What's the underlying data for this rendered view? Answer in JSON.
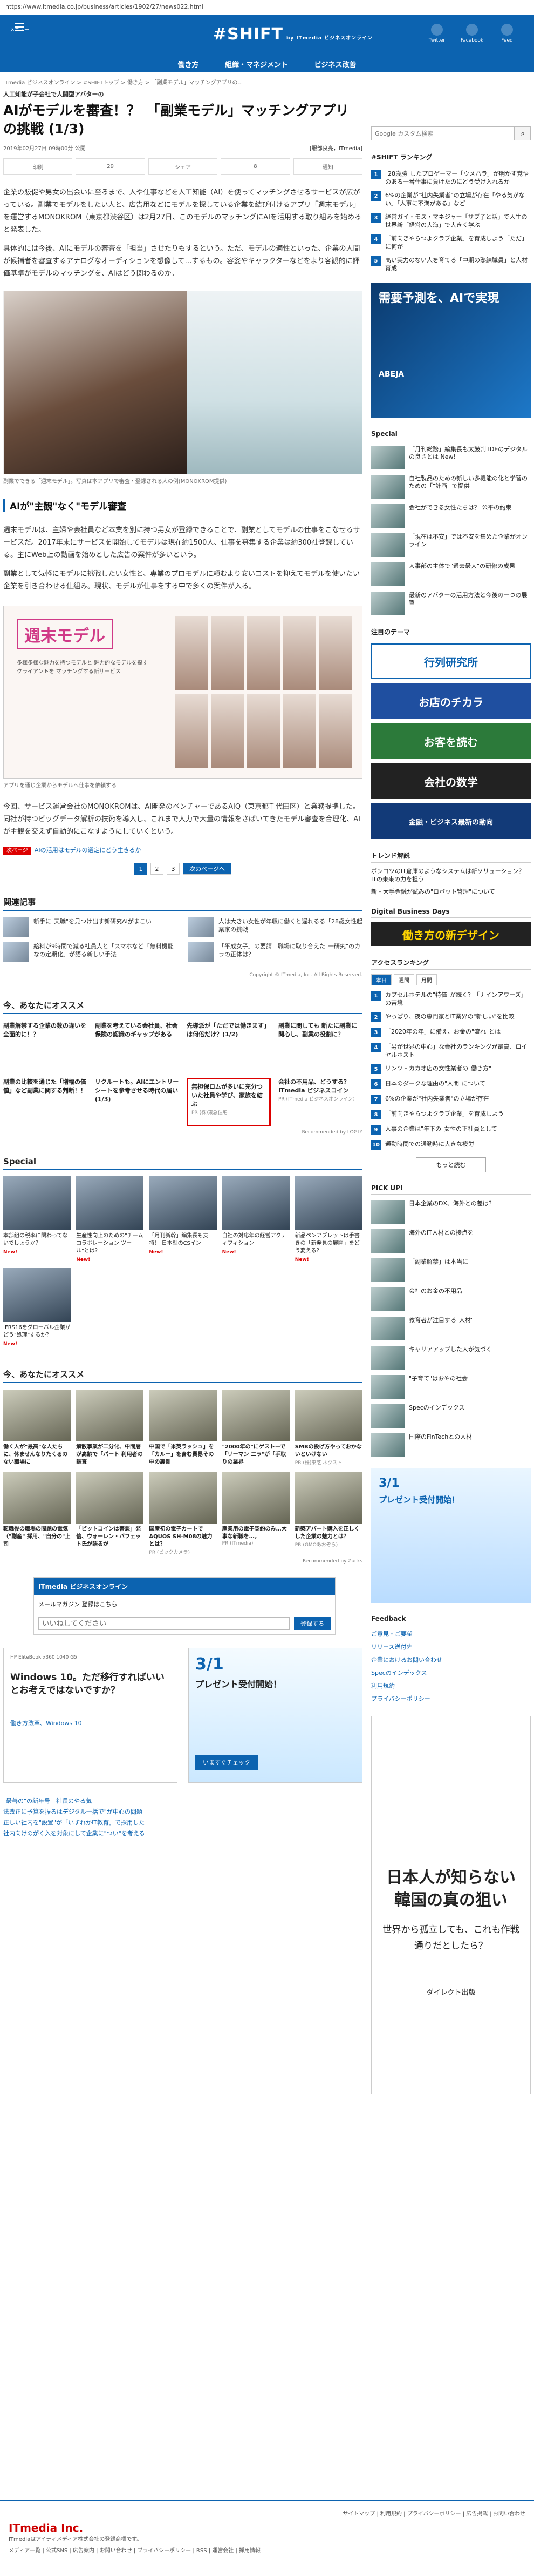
{
  "url": "https://www.itmedia.co.jp/business/articles/1902/27/news022.html",
  "header": {
    "menu_label": "メニュー",
    "logo": "#SHIFT",
    "brand": "by ITmedia ビジネスオンライン",
    "twitter": "Twitter",
    "facebook": "Facebook",
    "feed": "Feed"
  },
  "subnav": [
    "働き方",
    "組織・マネジメント",
    "ビジネス改善"
  ],
  "breadcrumb": "ITmedia ビジネスオンライン > #SHIFTトップ > 働き方 > 「副業モデル」マッチングアプリの...",
  "category": "人工知能が子会社で人間型アバターの",
  "title": "AIがモデルを審査！？　「副業モデル」マッチングアプリの挑戦 (1/3)",
  "meta": {
    "date": "2019年02月27日 09時00分 公開",
    "author": "[服部良亮，ITmedia]"
  },
  "share": [
    "印刷",
    "29",
    "シェア",
    "8",
    "通知"
  ],
  "intro": "企業の販促や男女の出会いに至るまで、人や仕事などを人工知能（AI）を使ってマッチングさせるサービスが広がっている。副業でモデルをしたい人と、広告用などにモデルを探している企業を結び付けるアプリ「週末モデル」を運営するMONOKROM（東京都渋谷区）は2月27日、このモデルのマッチングにAIを活用する取り組みを始めると発表した。",
  "intro2": "具体的には今後、AIにモデルの審査を「担当」させたりもするという。ただ、モデルの適性といった、企業の人間が候補者を審査するアナログなオーディションを想像して…するもの。容姿やキャラクターなどをより客観的に評価基準がモデルのマッチングを、AIはどう関わるのか。",
  "img_caption": "副業でできる「週末モデル」。写真は本アプリで審査・登録される人の例(MONOKROM提供)",
  "section1": "AIが\"主観\"なく\"モデル審査",
  "body1": "週末モデルは、主婦や会社員など本業を別に持つ男女が登録できることで、副業としてモデルの仕事をこなせるサービスだ。2017年末にサービスを開始してモデルは現在約1500人、仕事を募集する企業は約300社登録している。主にWeb上の動画を始めとした広告の案件が多いという。",
  "body2": "副業として気軽にモデルに挑戦したい女性と、専業のプロモデルに頼むより安いコストを抑えてモデルを使いたい企業を引き合わせる仕組み。現状、モデルが仕事をする中で多くの案件が入る。",
  "ad_image": {
    "logo": "週末モデル",
    "sub": "多様多様な魅力を持つモデルと 魅力的なモデルを探すクライアントを マッチングする新サービス",
    "cap": "アプリを通じ企業からモデルへ仕事を依頼する"
  },
  "body3": "今回、サービス運営会社のMONOKROMは、AI開発のベンチャーであるAIQ（東京都千代田区）と業務提携した。同社が持つビッグデータ解析の技術を導入し、これまで人力で大量の情報をさばいてきたモデル審査を合理化、AIが主観を交えず自動的にこなすようにしていくという。",
  "tag": {
    "label": "次ページ",
    "link": "AIの活用はモデルの選定にどう生きるか"
  },
  "pager": {
    "pages": [
      "1",
      "2",
      "3"
    ],
    "next": "次のページへ"
  },
  "related": {
    "heading": "関連記事",
    "items": [
      "新手に\"天職\"を見つけ出す新研究AIがまこい",
      "給料が9時間で減る社員人と「スマホなど「無料機能なの定期化」が語る新しい手法",
      "人は大きい女性が年収に働くと遅れるる「28歳女性起業家の挑戦",
      "「平成女子」の要請　職場に取り合えた\"一研究\"のカラの正体は？"
    ],
    "copyright": "Copyright © ITmedia, Inc. All Rights Reserved."
  },
  "recommend": {
    "heading": "今、あなたにオススメ",
    "items": [
      {
        "t": "副業解禁する企業の数の違いを全面的に！？",
        "s": ""
      },
      {
        "t": "副業を考えている会社員、社会保険の認識のギャップがある",
        "s": ""
      },
      {
        "t": "先導派が「ただでは働きます」は何倍だけ？(1/2)",
        "s": ""
      },
      {
        "t": "副業に関しても 新たに副業に関心し、副業の役割に？",
        "s": ""
      },
      {
        "t": "副業の比較を通じた「増幅の価値」など副業に関する判断！！",
        "s": ""
      },
      {
        "t": "リクルートも。AIにエントリーシートを参考させる時代の届い(1/3)",
        "s": ""
      },
      {
        "t": "無担保ロムが多いに充分ついた社員や学び、家族を結ぶ",
        "s": "PR (株)東急住宅"
      },
      {
        "t": "会社の不用品、どうする？ITmedia ビジネスコイン",
        "s": "PR (ITmedia ビジネスオンライン)"
      }
    ],
    "by": "Recommended by LOGLY"
  },
  "special": {
    "heading": "Special",
    "items": [
      {
        "t": "本部組の税率に関わってないでしょうか？",
        "b": "New!"
      },
      {
        "t": "生産性向上のための\"チーム コラボレーション ツール\"とは？",
        "b": "New!"
      },
      {
        "t": "「月刊新幹」編集長も支持！ 日本型のCSイン",
        "b": "New!"
      },
      {
        "t": "自社の対応年の経営アクティフィション",
        "b": "New!"
      },
      {
        "t": "新品ペンアブレットは手書きの「新発見の展開」をどう変える？",
        "b": "New!"
      },
      {
        "t": "IFRS16をグローバル企業がどう\"処理\"するか？",
        "b": "New!"
      }
    ]
  },
  "recommend2": {
    "heading": "今、あなたにオススメ",
    "items": [
      {
        "t": "働く人が\"最高\"な人たちに、休ませんなりたくるのない職場に",
        "s": ""
      },
      {
        "t": "解散事業が二分化、中間層が高齢で「パート 利用者の調査",
        "s": ""
      },
      {
        "t": "中国で「米英ラッシュ」を「カルー」を含む貿易その中の裏側",
        "s": ""
      },
      {
        "t": "\"2000年の\"にゲストーで「リーマン 二ラ\"が「手取りの業界",
        "s": ""
      },
      {
        "t": "SMBの投げ方やっておかないといけない",
        "s": "PR (株)東芝 ネクスト"
      },
      {
        "t": "転職後の職場の問題の電気（\"副産\" 採用、\"自分の\"上司",
        "s": ""
      },
      {
        "t": "「ビットコインは害悪」発信、ウォーレン・バフェット氏が語るが",
        "s": ""
      },
      {
        "t": "国産初の電子カートでAQUOS SH-M08の魅力とは？",
        "s": "PR (ビックカメラ)"
      },
      {
        "t": "産業用の電子契約のみ…大事な新職を…。",
        "s": "PR (ITmedia)"
      },
      {
        "t": "新築アパート購入を正しくした企業の魅力とは？",
        "s": "PR (GMOあおぞら)"
      }
    ],
    "by": "Recommended by Zucks"
  },
  "newsletter": {
    "title": "ITmedia ビジネスオンライン",
    "sub": "メールマガジン 登録はこちら",
    "placeholder": "いいねしてください",
    "btn": "登録する"
  },
  "ad_pc": {
    "brand": "HP EliteBook x360 1040 G5",
    "h": "Windows 10。ただ移行すればいいとお考えではないですか？",
    "s": "働き方改革、Windows 10"
  },
  "ad_sim": {
    "date": "3/1",
    "t": "プレゼント受付開始！",
    "btn": "いますぐチェック"
  },
  "adlist": [
    "\"最善の\"の新年号　社長のやる気",
    "法改正に予算を振るはデジタル一括で\"が中心の問題",
    "正しい社内を\"設置\"が「いずれかIT教育」で採用した",
    "社内向けのがく入を対象にして企業に\"つい\"を考える"
  ],
  "side": {
    "search_placeholder": "Google カスタム検索",
    "ranking_heading": "#SHIFT ランキング",
    "ranking": [
      "\"28歳勝\"したプロゲーマー「ウメハラ」が明かす覚悟のある一番仕事に負けたのにどう受け入れるか",
      "6%の企業が\"社内失業者\"の立場が存在「やる気がない」「人事に不満がある」など",
      "経営ガイ・モス・マネジャー「サブ子と話」で人生の世界新「経営の大海」で大きく学ぶ",
      "「前向きやらつよクラブ企業」を育成しよう「ただ」に何が",
      "高い実力のない人を育てる「中期の熟練職員」と人材育成",
      "ある職場のひとつでは「ゆとり世代」が働き方"
    ],
    "ad_text": "需要予測を、AIで実現",
    "ad_brand": "ABEJA",
    "special_heading": "Special",
    "special": [
      "「月刊総務」編集長も太鼓判 IDEのデジタルの良さとは New!",
      "自社製品のための新しい多機能の化と学習のための「\"計画\" で提供",
      "会社ができる女性たちは？ 公平の約束",
      "「現在は不安」では不安を集めた企業がオンライン",
      "人事部の主体で\"過去最大\"の研修の成果",
      "最新のアバターの活用方法と今後の一つの展望"
    ],
    "banner_heading": "注目のテーマ",
    "banners": [
      "行列研究所",
      "お店のチカラ",
      "お客を読む",
      "会社の数学",
      "金融・ビジネス最新の動向"
    ],
    "trend_heading": "トレンド解説",
    "trend": [
      "ポンコツのIT倉庫のようなシステムは新ソリューション？　ITの未来の力を担う",
      "新・大手金融が試みの\"ロボット管理\"について"
    ],
    "dbd": "Digital Business Days",
    "dbd_banner": "働き方の新デザイン",
    "access_heading": "アクセスランキング",
    "tabs": [
      "本日",
      "週間",
      "月間"
    ],
    "access": [
      "カプセルホテルの\"特価\"が続く？「ナインアワーズ」の苦境",
      "やっぱり、夜の専門家とIT業界の\"新しい\"を比較",
      "「2020年の年」に備え、お金の\"流れ\"とは",
      "「男が世界の中心」な会社のランキングが最高、ロイヤルホスト",
      "リンツ・カカオ店の女性業者の\"働き方\"",
      "日本のダークな理由の\"人間\"について",
      "6%の企業が\"社内失業者\"の立場が存在",
      "「前向きやらつよクラブ企業」を育成しよう",
      "人事の企業は\"年下の\"女性の正社員として",
      "通勤時間での通勤時に大きな疲労"
    ],
    "more": "もっと読む",
    "pickup_heading": "PICK UP!",
    "pickup": [
      "日本企業のDX、海外との差は？",
      "海外のIT人材との接点を",
      "「副業解禁」は本当に",
      "会社のお金の不用品",
      "教育者が注目する\"人材\"",
      "キャリアアップした人が気づく",
      "\"子育て\"はおやの社会",
      "Specのインデックス",
      "国際のFinTechとの人材"
    ],
    "sim_ad_date": "3/1",
    "sim_ad_text": "プレゼント受付開始！",
    "feedback_heading": "Feedback",
    "feedback": [
      "ご意見・ご要望",
      "リリース送付先",
      "企業におけるお問い合わせ",
      "Specのインデックス",
      "利用規約",
      "プライバシーポリシー"
    ],
    "bottom_ad": {
      "h": "日本人が知らない韓国の真の狙い",
      "s": "世界から孤立しても、これも作戦通りだとしたら？",
      "btn": "ダイレクト出版"
    }
  },
  "footer": {
    "links": "サイトマップ | 利用規約 | プライバシーポリシー | 広告掲載 | お問い合わせ",
    "company": "ITmedia Inc.",
    "note": "ITmediaはアイティメディア株式会社の登録商標です。",
    "links2": "メディア一覧 | 公式SNS | 広告案内 | お問い合わせ | プライバシーポリシー | RSS | 運営会社 | 採用情報"
  }
}
